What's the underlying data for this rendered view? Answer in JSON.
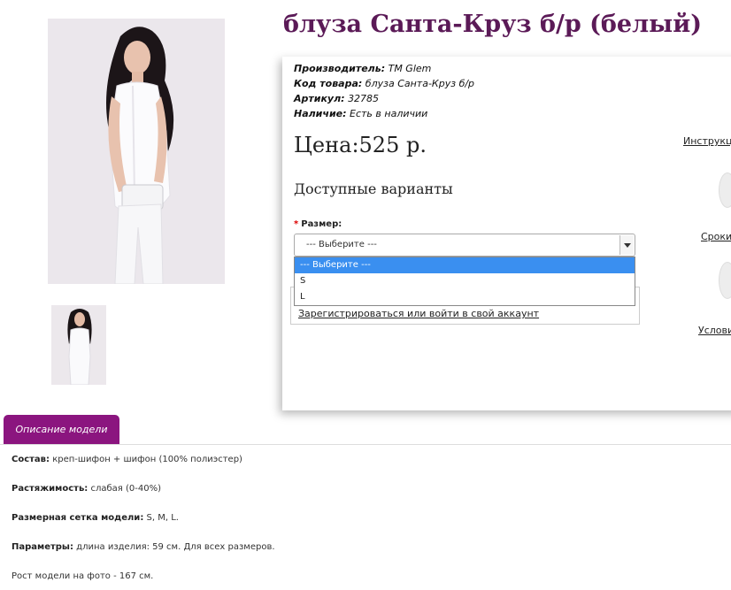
{
  "product": {
    "title": "блуза Санта-Круз б/р (белый)"
  },
  "meta": {
    "manufacturer_label": "Производитель:",
    "manufacturer_value": "TM Glem",
    "code_label": "Код товара:",
    "code_value": "блуза Санта-Круз б/р",
    "sku_label": "Артикул:",
    "sku_value": "32785",
    "availability_label": "Наличие:",
    "availability_value": "Есть в наличии"
  },
  "price": "Цена:525 р.",
  "variants_title": "Доступные варианты",
  "size": {
    "required_mark": "*",
    "label": "Размер:",
    "selected": "--- Выберите ---",
    "options": [
      "--- Выберите ---",
      "S",
      "L"
    ]
  },
  "login_link": "Зарегистрироваться или войти в свой аккаунт",
  "side_links": {
    "instructions": "Инструкц",
    "terms": "Сроки",
    "conditions": "Услови"
  },
  "tab_label": "Описание модели",
  "description": {
    "composition_label": "Состав:",
    "composition_value": "креп-шифон + шифон (100% полиэстер)",
    "stretch_label": "Растяжимость:",
    "stretch_value": "слабая (0-40%)",
    "sizes_label": "Размерная сетка модели:",
    "sizes_value": "S, M, L.",
    "params_label": "Параметры:",
    "params_value": "длина изделия: 59 см. Для всех размеров.",
    "height_text": "Рост модели на фото - 167 см."
  },
  "colors": {
    "title": "#5b1a57",
    "tab": "#8b157f",
    "dropdown_highlight": "#3a8ff0"
  }
}
